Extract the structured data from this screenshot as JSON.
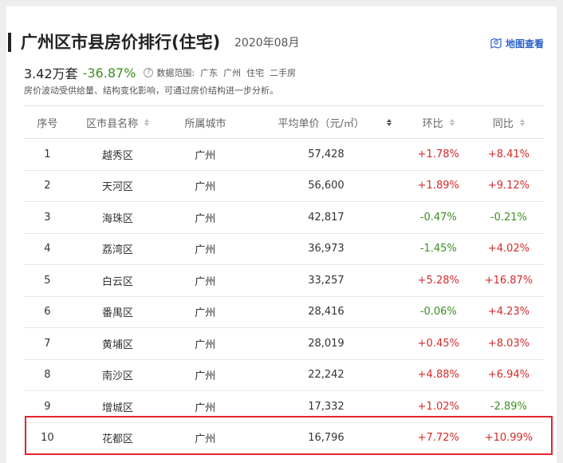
{
  "header": {
    "title": "广州区市县房价排行(住宅)",
    "period": "2020年08月",
    "map_link": "地图查看"
  },
  "summary": {
    "volume": "3.42万套",
    "change": "-36.87%",
    "scope_label": "数据范围:",
    "scope_tags": [
      "广东",
      "广州",
      "住宅",
      "二手房"
    ],
    "note": "房价波动受供给量、结构变化影响，可通过房价结构进一步分析。"
  },
  "table": {
    "columns": [
      "序号",
      "区市县名称",
      "所属城市",
      "平均单价（元/㎡）",
      "环比",
      "同比"
    ],
    "rows": [
      {
        "rank": "1",
        "name": "越秀区",
        "city": "广州",
        "price": "57,428",
        "mom": "+1.78%",
        "yoy": "+8.41%"
      },
      {
        "rank": "2",
        "name": "天河区",
        "city": "广州",
        "price": "56,600",
        "mom": "+1.89%",
        "yoy": "+9.12%"
      },
      {
        "rank": "3",
        "name": "海珠区",
        "city": "广州",
        "price": "42,817",
        "mom": "-0.47%",
        "yoy": "-0.21%"
      },
      {
        "rank": "4",
        "name": "荔湾区",
        "city": "广州",
        "price": "36,973",
        "mom": "-1.45%",
        "yoy": "+4.02%"
      },
      {
        "rank": "5",
        "name": "白云区",
        "city": "广州",
        "price": "33,257",
        "mom": "+5.28%",
        "yoy": "+16.87%"
      },
      {
        "rank": "6",
        "name": "番禺区",
        "city": "广州",
        "price": "28,416",
        "mom": "-0.06%",
        "yoy": "+4.23%"
      },
      {
        "rank": "7",
        "name": "黄埔区",
        "city": "广州",
        "price": "28,019",
        "mom": "+0.45%",
        "yoy": "+8.03%"
      },
      {
        "rank": "8",
        "name": "南沙区",
        "city": "广州",
        "price": "22,242",
        "mom": "+4.88%",
        "yoy": "+6.94%"
      },
      {
        "rank": "9",
        "name": "增城区",
        "city": "广州",
        "price": "17,332",
        "mom": "+1.02%",
        "yoy": "-2.89%"
      },
      {
        "rank": "10",
        "name": "花都区",
        "city": "广州",
        "price": "16,796",
        "mom": "+7.72%",
        "yoy": "+10.99%"
      }
    ]
  },
  "colors": {
    "positive": "#d42a2a",
    "negative": "#3b8f1e",
    "link": "#2a62c9",
    "highlight": "#e0252c"
  },
  "icons": {
    "map": "map-pin-icon",
    "help": "question-circle-icon",
    "sort": "sort-arrows-icon"
  }
}
